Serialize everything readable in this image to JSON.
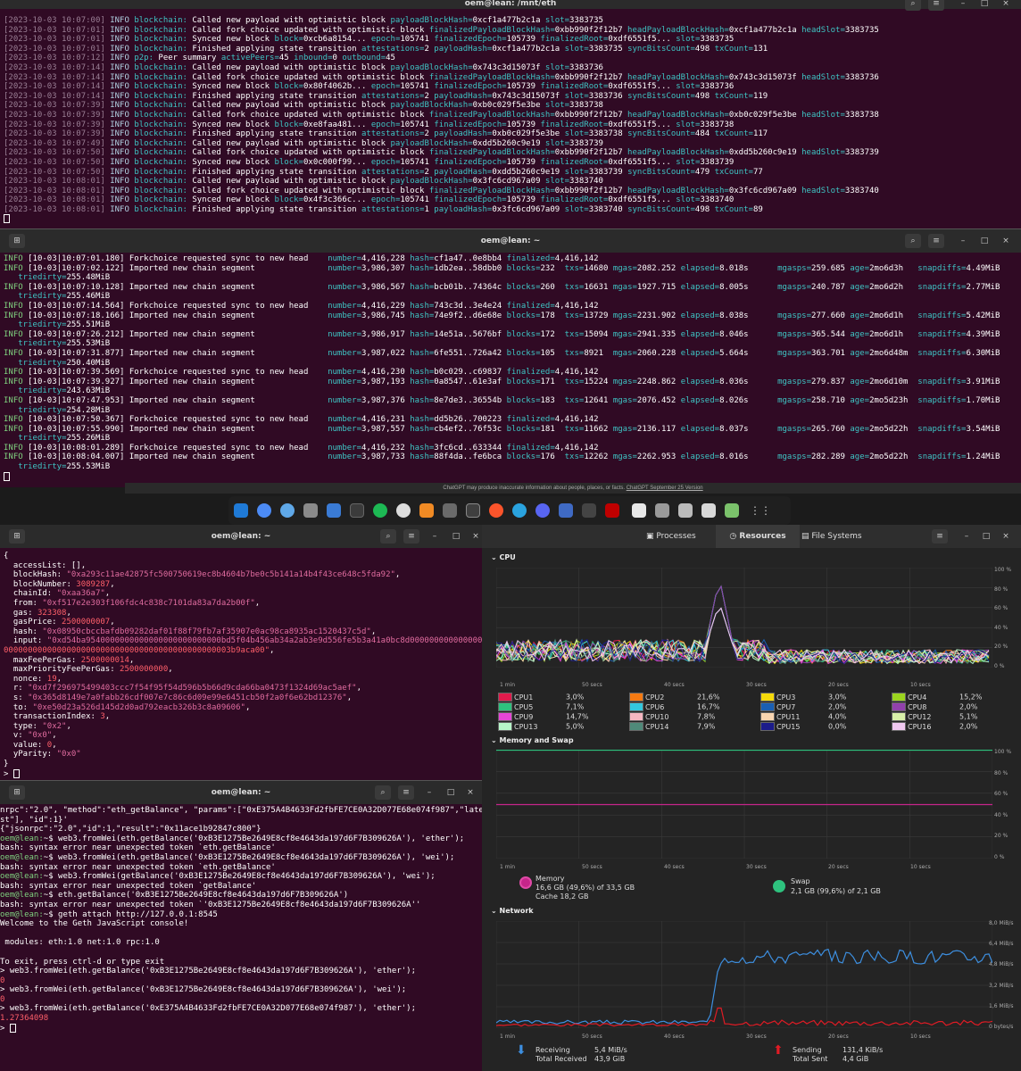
{
  "top": {
    "title": "oem@lean: /mnt/eth",
    "lines": [
      [
        "[2023-10-03 10:07:00]",
        "INFO",
        "blockchain:",
        "Called new payload with optimistic block",
        "payloadBlockHash=0xcf1a477b2c1a slot=3383735"
      ],
      [
        "[2023-10-03 10:07:01]",
        "INFO",
        "blockchain:",
        "Called fork choice updated with optimistic block",
        "finalizedPayloadBlockHash=0xbb990f2f12b7 headPayloadBlockHash=0xcf1a477b2c1a headSlot=3383735"
      ],
      [
        "[2023-10-03 10:07:01]",
        "INFO",
        "blockchain:",
        "Synced new block",
        "block=0xcb6a8154... epoch=105741 finalizedEpoch=105739 finalizedRoot=0xdf6551f5... slot=3383735"
      ],
      [
        "[2023-10-03 10:07:01]",
        "INFO",
        "blockchain:",
        "Finished applying state transition",
        "attestations=2 payloadHash=0xcf1a477b2c1a slot=3383735 syncBitsCount=498 txCount=131"
      ],
      [
        "[2023-10-03 10:07:12]",
        "INFO",
        "p2p:",
        "Peer summary",
        "activePeers=45 inbound=0 outbound=45"
      ],
      [
        "[2023-10-03 10:07:14]",
        "INFO",
        "blockchain:",
        "Called new payload with optimistic block",
        "payloadBlockHash=0x743c3d15073f slot=3383736"
      ],
      [
        "[2023-10-03 10:07:14]",
        "INFO",
        "blockchain:",
        "Called fork choice updated with optimistic block",
        "finalizedPayloadBlockHash=0xbb990f2f12b7 headPayloadBlockHash=0x743c3d15073f headSlot=3383736"
      ],
      [
        "[2023-10-03 10:07:14]",
        "INFO",
        "blockchain:",
        "Synced new block",
        "block=0x80f4062b... epoch=105741 finalizedEpoch=105739 finalizedRoot=0xdf6551f5... slot=3383736"
      ],
      [
        "[2023-10-03 10:07:14]",
        "INFO",
        "blockchain:",
        "Finished applying state transition",
        "attestations=2 payloadHash=0x743c3d15073f slot=3383736 syncBitsCount=498 txCount=119"
      ],
      [
        "[2023-10-03 10:07:39]",
        "INFO",
        "blockchain:",
        "Called new payload with optimistic block",
        "payloadBlockHash=0xb0c029f5e3be slot=3383738"
      ],
      [
        "[2023-10-03 10:07:39]",
        "INFO",
        "blockchain:",
        "Called fork choice updated with optimistic block",
        "finalizedPayloadBlockHash=0xbb990f2f12b7 headPayloadBlockHash=0xb0c029f5e3be headSlot=3383738"
      ],
      [
        "[2023-10-03 10:07:39]",
        "INFO",
        "blockchain:",
        "Synced new block",
        "block=0xe8faa481... epoch=105741 finalizedEpoch=105739 finalizedRoot=0xdf6551f5... slot=3383738"
      ],
      [
        "[2023-10-03 10:07:39]",
        "INFO",
        "blockchain:",
        "Finished applying state transition",
        "attestations=2 payloadHash=0xb0c029f5e3be slot=3383738 syncBitsCount=484 txCount=117"
      ],
      [
        "[2023-10-03 10:07:49]",
        "INFO",
        "blockchain:",
        "Called new payload with optimistic block",
        "payloadBlockHash=0xdd5b260c9e19 slot=3383739"
      ],
      [
        "[2023-10-03 10:07:50]",
        "INFO",
        "blockchain:",
        "Called fork choice updated with optimistic block",
        "finalizedPayloadBlockHash=0xbb990f2f12b7 headPayloadBlockHash=0xdd5b260c9e19 headSlot=3383739"
      ],
      [
        "[2023-10-03 10:07:50]",
        "INFO",
        "blockchain:",
        "Synced new block",
        "block=0x0c000f99... epoch=105741 finalizedEpoch=105739 finalizedRoot=0xdf6551f5... slot=3383739"
      ],
      [
        "[2023-10-03 10:07:50]",
        "INFO",
        "blockchain:",
        "Finished applying state transition",
        "attestations=2 payloadHash=0xdd5b260c9e19 slot=3383739 syncBitsCount=479 txCount=77"
      ],
      [
        "[2023-10-03 10:08:01]",
        "INFO",
        "blockchain:",
        "Called new payload with optimistic block",
        "payloadBlockHash=0x3fc6cd967a09 slot=3383740"
      ],
      [
        "[2023-10-03 10:08:01]",
        "INFO",
        "blockchain:",
        "Called fork choice updated with optimistic block",
        "finalizedPayloadBlockHash=0xbb990f2f12b7 headPayloadBlockHash=0x3fc6cd967a09 headSlot=3383740"
      ],
      [
        "[2023-10-03 10:08:01]",
        "INFO",
        "blockchain:",
        "Synced new block",
        "block=0x4f3c366c... epoch=105741 finalizedEpoch=105739 finalizedRoot=0xdf6551f5... slot=3383740"
      ],
      [
        "[2023-10-03 10:08:01]",
        "INFO",
        "blockchain:",
        "Finished applying state transition",
        "attestations=1 payloadHash=0x3fc6cd967a09 slot=3383740 syncBitsCount=498 txCount=89"
      ]
    ]
  },
  "mid": {
    "title": "oem@lean: ~",
    "lines": [
      [
        "INFO [10-03|10:07:01.180] Forkchoice requested sync to new head    ",
        "number=4,416,228 hash=cf1a47..0e8bb4 finalized=4,416,142",
        "",
        ""
      ],
      [
        "INFO [10-03|10:07:02.122] Imported new chain segment               ",
        "number=3,986,307 hash=1db2ea..58dbb0 blocks=232  txs=14680 mgas=2082.252 elapsed=8.018s",
        "mgasps=259.685 age=2mo6d3h ",
        "snapdiffs=4.49MiB"
      ],
      [
        "   ",
        "triedirty=255.48MiB",
        "",
        ""
      ],
      [
        "INFO [10-03|10:07:10.128] Imported new chain segment               ",
        "number=3,986,567 hash=bcb01b..74364c blocks=260  txs=16631 mgas=1927.715 elapsed=8.005s",
        "mgasps=240.787 age=2mo6d2h ",
        "snapdiffs=2.77MiB"
      ],
      [
        "   ",
        "triedirty=255.46MiB",
        "",
        ""
      ],
      [
        "INFO [10-03|10:07:14.564] Forkchoice requested sync to new head    ",
        "number=4,416,229 hash=743c3d..3e4e24 finalized=4,416,142",
        "",
        ""
      ],
      [
        "INFO [10-03|10:07:18.166] Imported new chain segment               ",
        "number=3,986,745 hash=74e9f2..d6e68e blocks=178  txs=13729 mgas=2231.902 elapsed=8.038s",
        "mgasps=277.660 age=2mo6d1h ",
        "snapdiffs=5.42MiB"
      ],
      [
        "   ",
        "triedirty=255.51MiB",
        "",
        ""
      ],
      [
        "INFO [10-03|10:07:26.212] Imported new chain segment               ",
        "number=3,986,917 hash=14e51a..5676bf blocks=172  txs=15094 mgas=2941.335 elapsed=8.046s",
        "mgasps=365.544 age=2mo6d1h ",
        "snapdiffs=4.39MiB"
      ],
      [
        "   ",
        "triedirty=255.53MiB",
        "",
        ""
      ],
      [
        "INFO [10-03|10:07:31.877] Imported new chain segment               ",
        "number=3,987,022 hash=6fe551..726a42 blocks=105  txs=8921  mgas=2060.228 elapsed=5.664s",
        "mgasps=363.701 age=2mo6d48m",
        "snapdiffs=6.30MiB"
      ],
      [
        "   ",
        "triedirty=250.40MiB",
        "",
        ""
      ],
      [
        "INFO [10-03|10:07:39.569] Forkchoice requested sync to new head    ",
        "number=4,416,230 hash=b0c029..c69837 finalized=4,416,142",
        "",
        ""
      ],
      [
        "INFO [10-03|10:07:39.927] Imported new chain segment               ",
        "number=3,987,193 hash=0a8547..61e3af blocks=171  txs=15224 mgas=2248.862 elapsed=8.036s",
        "mgasps=279.837 age=2mo6d10m",
        "snapdiffs=3.91MiB"
      ],
      [
        "   ",
        "triedirty=243.63MiB",
        "",
        ""
      ],
      [
        "INFO [10-03|10:07:47.953] Imported new chain segment               ",
        "number=3,987,376 hash=8e7de3..36554b blocks=183  txs=12641 mgas=2076.452 elapsed=8.026s",
        "mgasps=258.710 age=2mo5d23h",
        "snapdiffs=1.70MiB"
      ],
      [
        "   ",
        "triedirty=254.28MiB",
        "",
        ""
      ],
      [
        "INFO [10-03|10:07:50.367] Forkchoice requested sync to new head    ",
        "number=4,416,231 hash=dd5b26..700223 finalized=4,416,142",
        "",
        ""
      ],
      [
        "INFO [10-03|10:07:55.990] Imported new chain segment               ",
        "number=3,987,557 hash=cb4ef2..76f53c blocks=181  txs=11662 mgas=2136.117 elapsed=8.037s",
        "mgasps=265.760 age=2mo5d22h",
        "snapdiffs=3.54MiB"
      ],
      [
        "   ",
        "triedirty=255.26MiB",
        "",
        ""
      ],
      [
        "INFO [10-03|10:08:01.289] Forkchoice requested sync to new head    ",
        "number=4,416,232 hash=3fc6cd..633344 finalized=4,416,142",
        "",
        ""
      ],
      [
        "INFO [10-03|10:08:04.007] Imported new chain segment               ",
        "number=3,987,733 hash=88f4da..fe6bca blocks=176  txs=12262 mgas=2262.953 elapsed=8.016s",
        "mgasps=282.289 age=2mo5d22h",
        "snapdiffs=1.24MiB"
      ],
      [
        "   ",
        "triedirty=255.53MiB",
        "",
        ""
      ]
    ],
    "notice": "ChatGPT may produce inaccurate information about people, places, or facts.",
    "notice_link": "ChatGPT September 25 Version"
  },
  "left1": {
    "title": "oem@lean: ~",
    "lines": [
      [
        "{"
      ],
      [
        "  accessList: [],"
      ],
      [
        "  blockHash: ",
        "\"0xa293c11ae42875fc500750619ec8b4604b7be0c5b141a14b4f43ce648c5fda92\"",
        ","
      ],
      [
        "  blockNumber: ",
        "3089287",
        ","
      ],
      [
        "  chainId: ",
        "\"0xaa36a7\"",
        ","
      ],
      [
        "  from: ",
        "\"0xf517e2e303f106fdc4c838c7101da83a7da2b00f\"",
        ","
      ],
      [
        "  gas: ",
        "323308",
        ","
      ],
      [
        "  gasPrice: ",
        "2500000007",
        ","
      ],
      [
        "  hash: ",
        "\"0x08950cbccbafdb09282daf01f88f79fb7af35907e0ac98ca8935ac1520437c5d\"",
        ","
      ],
      [
        "  input: ",
        "\"0xd54ba9540000000000000000000000000bd5f04b456ab34a2ab3e9d556fe5b3a41a0bc8d0000000000000000",
        "",
        ""
      ],
      [
        "",
        "00000000000000000000000000000000000000000000003b9aca00\"",
        ","
      ],
      [
        "  maxFeePerGas: ",
        "2500000014",
        ","
      ],
      [
        "  maxPriorityFeePerGas: ",
        "2500000000",
        ","
      ],
      [
        "  nonce: ",
        "19",
        ","
      ],
      [
        "  r: ",
        "\"0xd7f296975499403ccc7f54f95f54d596b5b66d9cda66ba0473f1324d69ac5aef\"",
        ","
      ],
      [
        "  s: ",
        "\"0x365d8149e7a0fabb26cdf007e7c86c6d09e99e6451cb50f2a0f6e62bd12376\"",
        ","
      ],
      [
        "  to: ",
        "\"0xe50d23a526d145d2d0ad792eacb326b3c8a09606\"",
        ","
      ],
      [
        "  transactionIndex: ",
        "3",
        ","
      ],
      [
        "  type: ",
        "\"0x2\"",
        ","
      ],
      [
        "  v: ",
        "\"0x0\"",
        ","
      ],
      [
        "  value: ",
        "0",
        ","
      ],
      [
        "  yParity: ",
        "\"0x0\""
      ],
      [
        "}"
      ]
    ]
  },
  "left2": {
    "title": "oem@lean: ~",
    "lines": [
      [
        "w",
        "nrpc\":\"2.0\", \"method\":\"eth_getBalance\", \"params\":[\"0xE375A4B4633Fd2fbFE7CE0A32D077E68e074f987\",\"late"
      ],
      [
        "w",
        "st\"], \"id\":1}'"
      ],
      [
        "w",
        "{\"jsonrpc\":\"2.0\",\"id\":1,\"result\":\"0x11ace1b92847c800\"}"
      ],
      [
        "p",
        "oem@lean:",
        "~$ web3.fromWei(eth.getBalance('0xB3E1275Be2649E8cf8e4643da197d6F7B309626A'), 'ether');"
      ],
      [
        "w",
        "bash: syntax error near unexpected token `eth.getBalance'"
      ],
      [
        "p",
        "oem@lean:",
        "~$ web3.fromWei(eth.getBalance('0xB3E1275Be2649E8cf8e4643da197d6F7B309626A'), 'wei');"
      ],
      [
        "w",
        "bash: syntax error near unexpected token `eth.getBalance'"
      ],
      [
        "p",
        "oem@lean:",
        "~$ web3.fromWei(getBalance('0xB3E1275Be2649E8cf8e4643da197d6F7B309626A'), 'wei');"
      ],
      [
        "w",
        "bash: syntax error near unexpected token `getBalance'"
      ],
      [
        "p",
        "oem@lean:",
        "~$ eth.getBalance('0xB3E1275Be2649E8cf8e4643da197d6F7B309626A')"
      ],
      [
        "w",
        "bash: syntax error near unexpected token `'0xB3E1275Be2649E8cf8e4643da197d6F7B309626A''"
      ],
      [
        "p",
        "oem@lean:",
        "~$ geth attach http://127.0.0.1:8545"
      ],
      [
        "w",
        "Welcome to the Geth JavaScript console!"
      ],
      [
        "w",
        ""
      ],
      [
        "w",
        " modules: eth:1.0 net:1.0 rpc:1.0"
      ],
      [
        "w",
        ""
      ],
      [
        "w",
        "To exit, press ctrl-d or type exit"
      ],
      [
        "w",
        "> web3.fromWei(eth.getBalance('0xB3E1275Be2649E8cf8e4643da197d6F7B309626A'), 'ether');"
      ],
      [
        "r",
        "0"
      ],
      [
        "w",
        "> web3.fromWei(eth.getBalance('0xB3E1275Be2649E8cf8e4643da197d6F7B309626A'), 'wei');"
      ],
      [
        "r",
        "0"
      ],
      [
        "w",
        "> web3.fromWei(eth.getBalance('0xE375A4B4633Fd2fbFE7CE0A32D077E68e074f987'), 'ether');"
      ],
      [
        "r",
        "1.27364098"
      ],
      [
        "w",
        "> "
      ]
    ]
  },
  "monitor": {
    "tabs": [
      "Processes",
      "Resources",
      "File Systems"
    ],
    "cpu_title": "CPU",
    "mem_title": "Memory and Swap",
    "net_title": "Network",
    "pct_labels": [
      "100 %",
      "80 %",
      "60 %",
      "40 %",
      "20 %",
      "0 %"
    ],
    "net_labels": [
      "8,0 MiB/s",
      "6,4 MiB/s",
      "4,8 MiB/s",
      "3,2 MiB/s",
      "1,6 MiB/s",
      "0 bytes/s"
    ],
    "time_labels": [
      "1 min",
      "50 secs",
      "40 secs",
      "30 secs",
      "20 secs",
      "10 secs"
    ],
    "cpus": [
      {
        "name": "CPU1",
        "val": "3,0%",
        "color": "#e01b4c"
      },
      {
        "name": "CPU2",
        "val": "21,6%",
        "color": "#f57a12"
      },
      {
        "name": "CPU3",
        "val": "3,0%",
        "color": "#f5d90a"
      },
      {
        "name": "CPU4",
        "val": "15,2%",
        "color": "#9bd41f"
      },
      {
        "name": "CPU5",
        "val": "7,1%",
        "color": "#2ec27e"
      },
      {
        "name": "CPU6",
        "val": "16,7%",
        "color": "#33c7de"
      },
      {
        "name": "CPU7",
        "val": "2,0%",
        "color": "#1a5fb4"
      },
      {
        "name": "CPU8",
        "val": "2,0%",
        "color": "#9141ac"
      },
      {
        "name": "CPU9",
        "val": "14,7%",
        "color": "#e645d6"
      },
      {
        "name": "CPU10",
        "val": "7,8%",
        "color": "#f6b7c1"
      },
      {
        "name": "CPU11",
        "val": "4,0%",
        "color": "#f9d5b0"
      },
      {
        "name": "CPU12",
        "val": "5,1%",
        "color": "#d8f0a8"
      },
      {
        "name": "CPU13",
        "val": "5,0%",
        "color": "#b6f5c8"
      },
      {
        "name": "CPU14",
        "val": "7,9%",
        "color": "#4f8a7a"
      },
      {
        "name": "CPU15",
        "val": "0,0%",
        "color": "#1c1c8a"
      },
      {
        "name": "CPU16",
        "val": "2,0%",
        "color": "#f0c8f0"
      }
    ],
    "memory": {
      "label": "Memory",
      "value": "16,6 GB (49,6%) of 33,5 GB",
      "cache": "Cache 18,2 GB",
      "percent": 49.6
    },
    "swap": {
      "label": "Swap",
      "value": "2,1 GB (99,6%) of 2,1 GB",
      "percent": 99.6
    },
    "receiving": {
      "label": "Receiving",
      "rate": "5,4 MiB/s",
      "total_label": "Total Received",
      "total": "43,9 GiB"
    },
    "sending": {
      "label": "Sending",
      "rate": "131,4 KiB/s",
      "total_label": "Total Sent",
      "total": "4,4 GiB"
    }
  }
}
